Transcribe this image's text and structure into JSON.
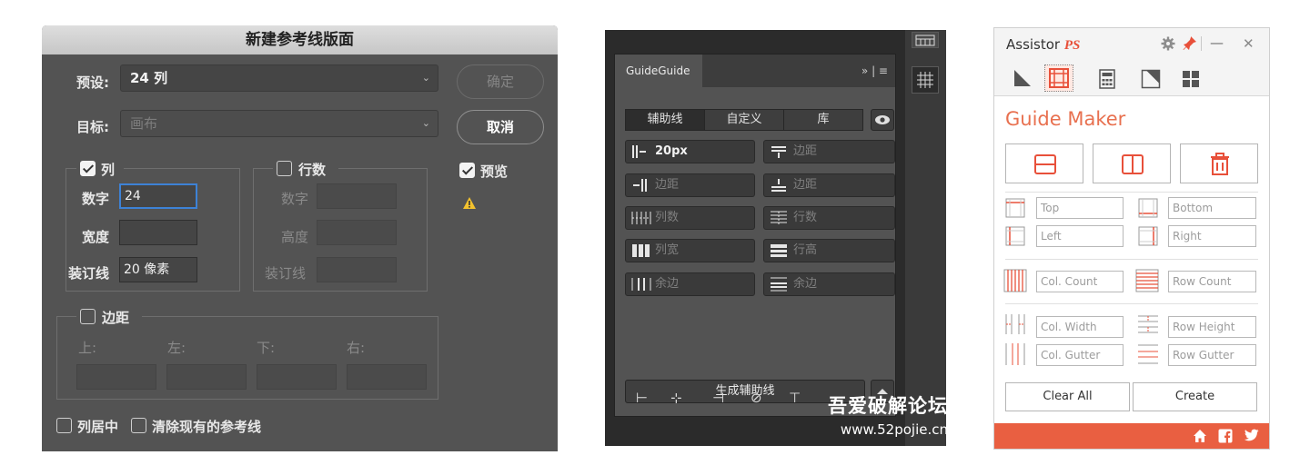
{
  "ps_dialog": {
    "title": "新建参考线版面",
    "preset_label": "预设:",
    "preset_value": "24 列",
    "target_label": "目标:",
    "target_value": "画布",
    "ok_label": "确定",
    "cancel_label": "取消",
    "preview_label": "预览",
    "columns": {
      "label": "列",
      "number_label": "数字",
      "number_value": "24",
      "width_label": "宽度",
      "width_value": "",
      "gutter_label": "装订线",
      "gutter_value": "20 像素"
    },
    "rows": {
      "label": "行数",
      "number_label": "数字",
      "height_label": "高度",
      "gutter_label": "装订线"
    },
    "margin": {
      "label": "边距",
      "top_label": "上:",
      "left_label": "左:",
      "bottom_label": "下:",
      "right_label": "右:"
    },
    "center_columns_label": "列居中",
    "clear_existing_label": "清除现有的参考线"
  },
  "guideguide": {
    "tab_label": "GuideGuide",
    "tab_controls": "»  |  ≡",
    "segments": [
      "辅助线",
      "自定义",
      "库"
    ],
    "left_fields": [
      {
        "value": "20px",
        "is_value": true
      },
      {
        "value": "边距",
        "is_value": false
      },
      {
        "value": "列数",
        "is_value": false
      },
      {
        "value": "列宽",
        "is_value": false
      },
      {
        "value": "余边",
        "is_value": false
      }
    ],
    "right_fields": [
      {
        "value": "边距"
      },
      {
        "value": "边距"
      },
      {
        "value": "行数"
      },
      {
        "value": "行高"
      },
      {
        "value": "余边"
      }
    ],
    "generate_label": "生成辅助线",
    "bottom_icons": [
      "⊢",
      "⊹",
      "⊣",
      "⊘",
      "⊤"
    ],
    "watermark_line1": "吾爱破解论坛",
    "watermark_line2": "www.52pojie.cn"
  },
  "assistor": {
    "title_prefix": "Assistor ",
    "title_suffix": "PS",
    "window_controls": {
      "minimize": "—",
      "close": "✕"
    },
    "section_title": "Guide Maker",
    "fields": {
      "top": "Top",
      "bottom": "Bottom",
      "left": "Left",
      "right": "Right",
      "col_count": "Col. Count",
      "row_count": "Row Count",
      "col_width": "Col. Width",
      "row_height": "Row Height",
      "col_gutter": "Col. Gutter",
      "row_gutter": "Row Gutter"
    },
    "clear_all_label": "Clear All",
    "create_label": "Create",
    "accent_color": "#e95f41"
  }
}
